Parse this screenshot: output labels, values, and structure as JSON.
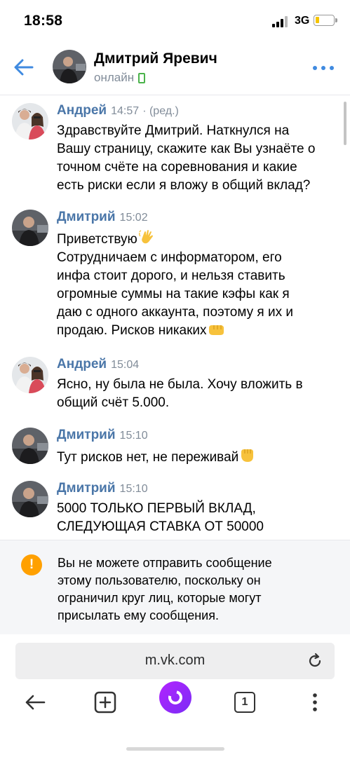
{
  "status_bar": {
    "time": "18:58",
    "network": "3G",
    "battery_level": 0.2
  },
  "header": {
    "back_icon": "arrow-left-icon",
    "contact_name": "Дмитрий Яревич",
    "contact_status": "онлайн",
    "more_icon": "more-dots-icon"
  },
  "messages": [
    {
      "author": "Андрей",
      "time": "14:57",
      "edited": "· (ред.)",
      "lines": [
        "Здравствуйте Дмитрий. Наткнулся на",
        "Вашу страницу, скажите как Вы узнаёте о",
        "точном счёте на соревнования и какие",
        "есть риски если я вложу в общий вклад?"
      ]
    },
    {
      "author": "Дмитрий",
      "time": "15:02",
      "lines": [
        "Приветствую",
        "Сотрудничаем с информатором, его",
        "инфа стоит дорого, и нельзя ставить",
        "огромные суммы на такие кэфы как я",
        "даю с одного аккаунта, поэтому я их и",
        "продаю. Рисков никаких"
      ]
    },
    {
      "author": "Андрей",
      "time": "15:04",
      "lines": [
        "Ясно, ну была не была. Хочу вложить в",
        "общий счёт 5.000."
      ]
    },
    {
      "author": "Дмитрий",
      "time": "15:10",
      "lines": [
        "Тут рисков нет, не переживай"
      ]
    },
    {
      "author": "Дмитрий",
      "time": "15:10",
      "lines": [
        "5000 ТОЛЬКО ПЕРВЫЙ ВКЛАД,",
        "СЛЕДУЮЩАЯ СТАВКА ОТ 50000"
      ]
    }
  ],
  "warning": {
    "icon": "exclamation-icon",
    "lines": [
      "Вы не можете отправить сообщение",
      "этому пользователю, поскольку он",
      "ограничил круг лиц, которые могут",
      "присылать ему сообщения."
    ]
  },
  "browser": {
    "url": "m.vk.com",
    "tab_count": "1"
  },
  "colors": {
    "accent": "#4a76a8",
    "link_blue": "#3f8ae0",
    "warning": "#ffa000",
    "online": "#4bb34b",
    "alice": "#9b29f7"
  }
}
